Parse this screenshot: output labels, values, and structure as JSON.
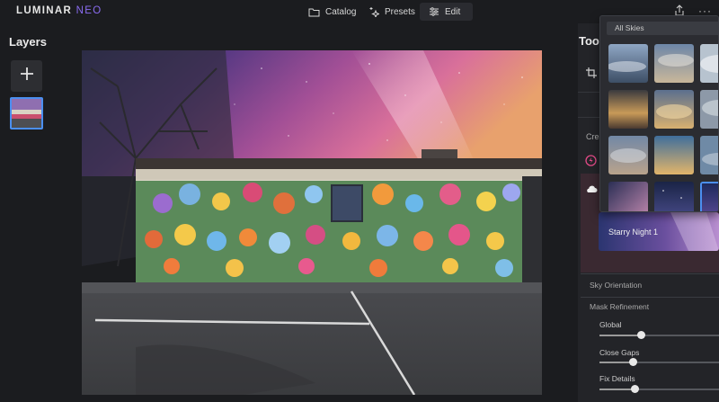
{
  "app": {
    "logo_main": "LUMINAR",
    "logo_accent": "NEO"
  },
  "nav": {
    "catalog": "Catalog",
    "presets": "Presets",
    "edit": "Edit",
    "active": "Edit"
  },
  "layers": {
    "title": "Layers"
  },
  "tools": {
    "title": "Too",
    "creative_label": "Crea"
  },
  "sky": {
    "search_value": "All Skies",
    "selected_preview": "Starry Night 1",
    "thumbnails": [
      "sky-1",
      "sky-2",
      "sky-3",
      "sky-4",
      "sky-5",
      "sky-6",
      "sky-7",
      "sky-8",
      "sky-9",
      "sky-10",
      "sky-11",
      "sky-12"
    ],
    "selected_index": 11
  },
  "sections": {
    "sky_orientation": "Sky Orientation",
    "mask_refinement": "Mask Refinement"
  },
  "sliders": [
    {
      "label": "Global",
      "value": 0.35
    },
    {
      "label": "Close Gaps",
      "value": 0.28
    },
    {
      "label": "Fix Details",
      "value": 0.29
    }
  ],
  "colors": {
    "accent": "#4b8ff0",
    "logo_accent": "#8a6cf0",
    "background": "#1b1c1f"
  }
}
